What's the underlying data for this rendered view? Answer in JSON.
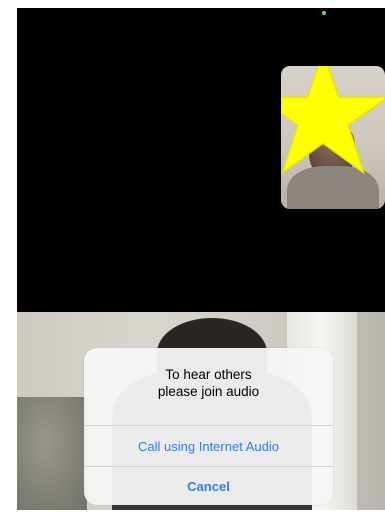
{
  "dialog": {
    "title": "To hear others\nplease join audio",
    "actions": {
      "internet_audio": "Call using Internet Audio",
      "cancel": "Cancel"
    }
  },
  "colors": {
    "accent": "#2f7bf5",
    "star": "#ffff00",
    "background": "#000000"
  },
  "icons": {
    "self_view_overlay": "star-icon"
  }
}
